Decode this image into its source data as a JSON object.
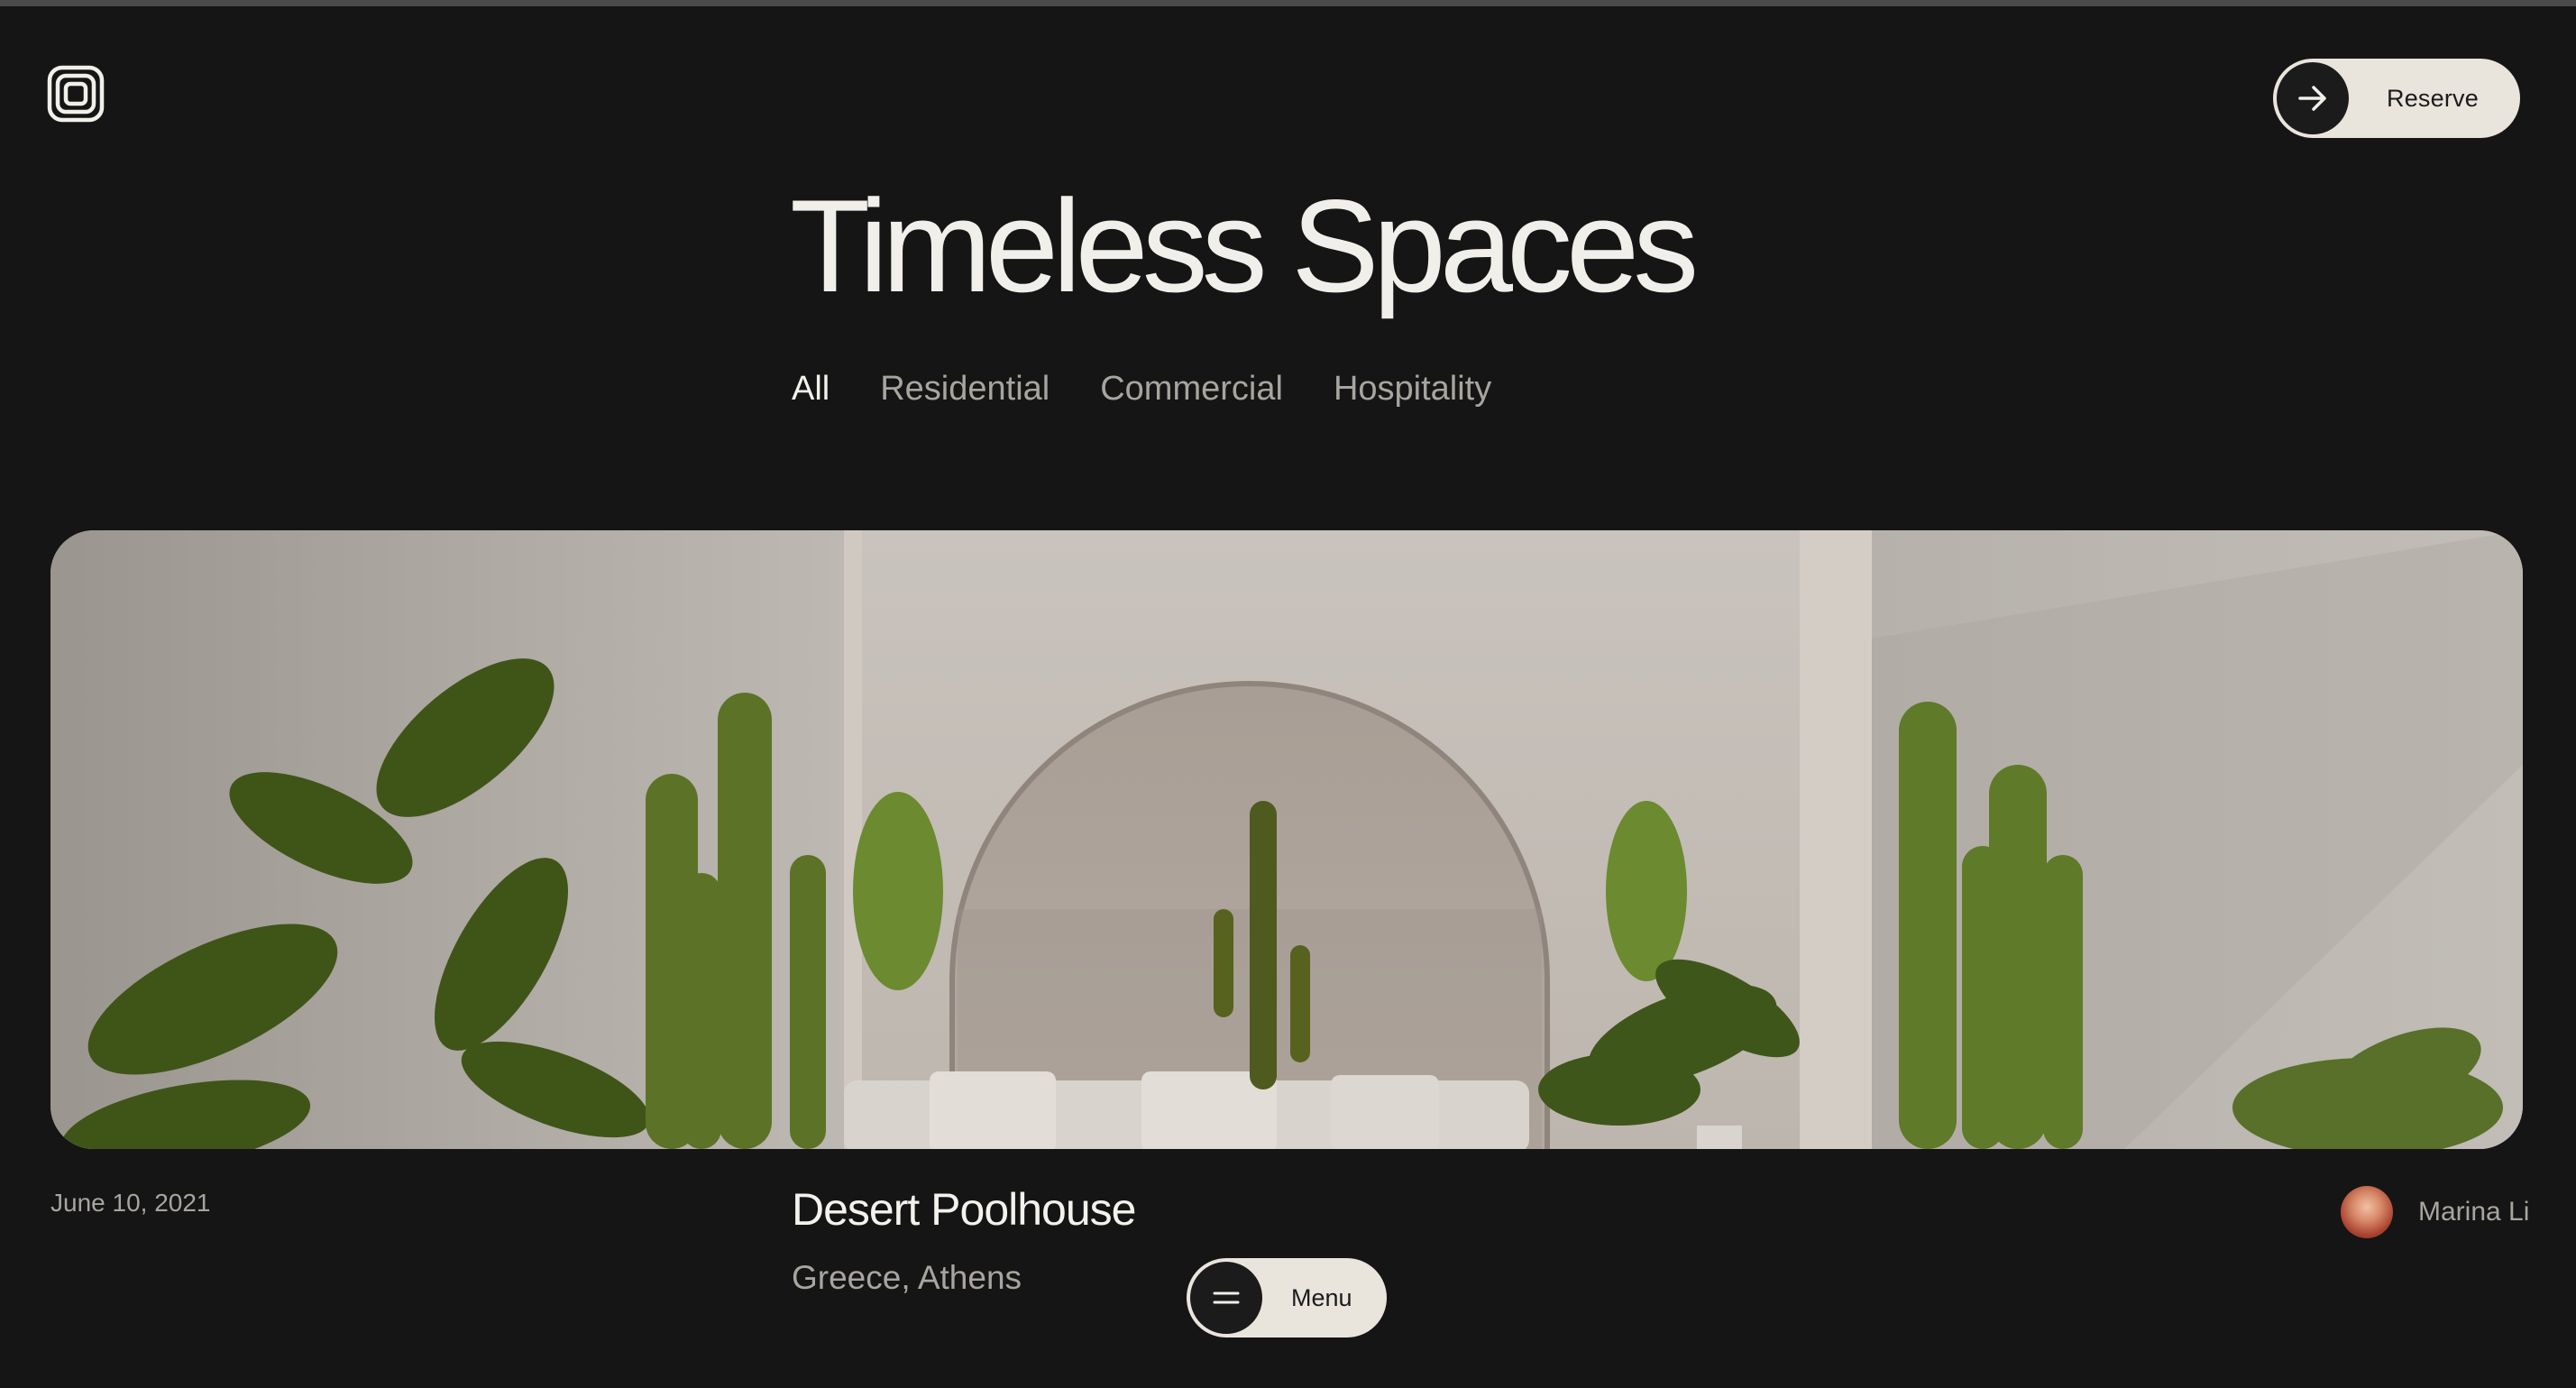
{
  "header": {
    "logo_icon": "concentric-square-spiral-logo",
    "reserve_label": "Reserve",
    "reserve_icon": "arrow-right-icon"
  },
  "main": {
    "title": "Timeless Spaces",
    "tabs": [
      {
        "label": "All",
        "active": true
      },
      {
        "label": "Residential",
        "active": false
      },
      {
        "label": "Commercial",
        "active": false
      },
      {
        "label": "Hospitality",
        "active": false
      }
    ]
  },
  "project": {
    "date": "June 10, 2021",
    "title": "Desert Poolhouse",
    "location": "Greece, Athens",
    "author": "Marina Li"
  },
  "menu": {
    "label": "Menu",
    "icon": "hamburger-icon"
  },
  "colors": {
    "background": "#151515",
    "text_primary": "#f1efe9",
    "text_muted": "#a8a59f",
    "button_bg": "#e9e5dd"
  }
}
